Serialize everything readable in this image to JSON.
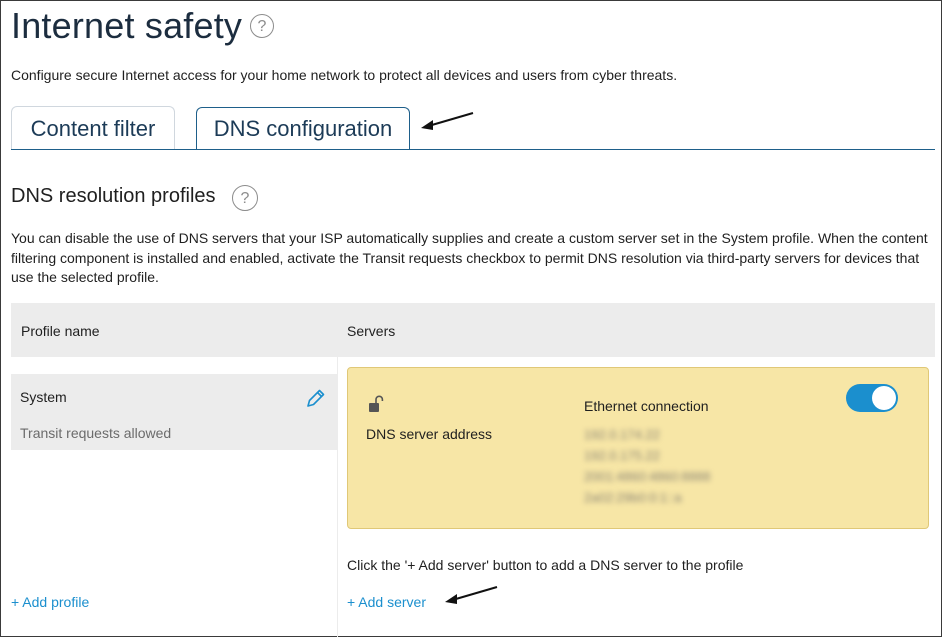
{
  "page": {
    "title": "Internet safety",
    "description": "Configure secure Internet access for your home network to protect all devices and users from cyber threats."
  },
  "icons": {
    "help": "question-circle-icon",
    "edit": "pencil-icon",
    "lock": "unlock-icon",
    "arrow": "arrow-icon"
  },
  "tabs": [
    {
      "label": "Content filter",
      "active": false
    },
    {
      "label": "DNS configuration",
      "active": true
    }
  ],
  "section": {
    "title": "DNS resolution profiles",
    "paragraph": "You can disable the use of DNS servers that your ISP automatically supplies and create a custom server set in the System profile. When the content filtering component is installed and enabled, activate the Transit requests checkbox to permit DNS resolution via third-party servers for devices that use the selected profile."
  },
  "table": {
    "col_profile": "Profile name",
    "col_servers": "Servers"
  },
  "profile": {
    "name": "System",
    "status": "Transit requests allowed"
  },
  "server_card": {
    "label": "DNS server address",
    "connection": "Ethernet connection",
    "enabled": true,
    "addresses": [
      "192.0.174.22",
      "192.0.175.22",
      "2001:4860:4860:8888",
      "2a02:29b0:0:1::a"
    ]
  },
  "hint": "Click the '+ Add server' button to add a DNS server to the profile",
  "actions": {
    "add_profile": "+ Add profile",
    "add_server": "+ Add server"
  },
  "colors": {
    "accent": "#1b8fce",
    "card_bg": "#f7e6a6",
    "tab_border": "#1e5f8a"
  }
}
